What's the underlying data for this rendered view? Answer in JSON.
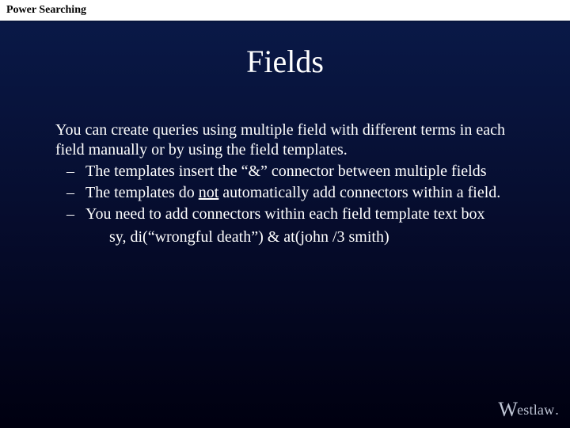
{
  "header": "Power Searching",
  "title": "Fields",
  "intro": "You can create queries using multiple field with different terms in each field manually or by using the field templates.",
  "bullets": [
    {
      "dash": "–",
      "pre": "The templates insert the “&” connector between multiple fields",
      "under": "",
      "post": ""
    },
    {
      "dash": "–",
      "pre": "The templates do ",
      "under": "not",
      "post": " automatically add connectors within a field."
    },
    {
      "dash": "–",
      "pre": "You need to add connectors within each field template text box",
      "under": "",
      "post": ""
    }
  ],
  "example": "sy, di(“wrongful death”) & at(john  /3 smith)",
  "logo": {
    "w": "W",
    "rest": "estlaw",
    "dot": "."
  }
}
